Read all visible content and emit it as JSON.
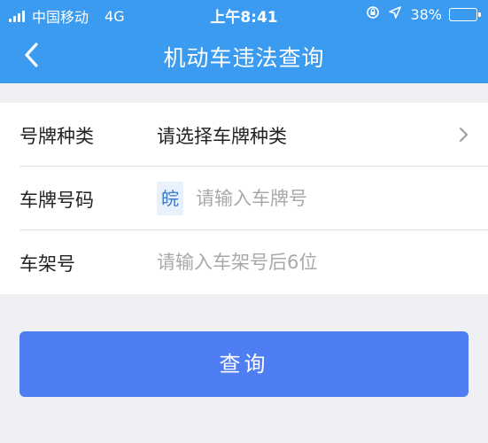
{
  "status_bar": {
    "carrier": "中国移动",
    "network": "4G",
    "time": "上午8:41",
    "battery_label": "38%",
    "battery_level": 0.38,
    "icons": [
      "signal-icon",
      "orientation-lock-icon",
      "location-icon",
      "battery-icon"
    ]
  },
  "nav": {
    "title": "机动车违法查询",
    "back_icon": "chevron-left-icon"
  },
  "form": {
    "plate_type": {
      "label": "号牌种类",
      "value": "请选择车牌种类",
      "icon": "chevron-right-icon"
    },
    "plate_number": {
      "label": "车牌号码",
      "province": "皖",
      "placeholder": "请输入车牌号"
    },
    "vin": {
      "label": "车架号",
      "placeholder": "请输入车架号后6位"
    }
  },
  "actions": {
    "query_label": "查询"
  },
  "colors": {
    "header": "#3b9bf0",
    "button": "#4f7ef2",
    "background": "#eff0f4"
  }
}
